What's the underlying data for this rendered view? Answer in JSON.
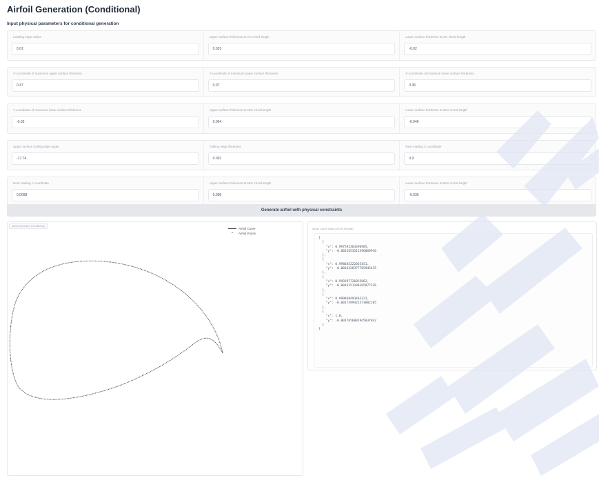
{
  "app": {
    "title": "Airfoil Generation (Conditional)",
    "subtitle": "Input physical parameters for conditional generation"
  },
  "params": [
    [
      {
        "label": "Leading edge radius",
        "value": "0.01"
      },
      {
        "label": "Upper surface thickness at 4% chord length",
        "value": "0.033"
      },
      {
        "label": "Lower surface thickness at 4% chord length",
        "value": "-0.02"
      }
    ],
    [
      {
        "label": "X-coordinate of maximum upper surface thickness",
        "value": "0.47"
      },
      {
        "label": "Y-coordinate of maximum upper surface thickness",
        "value": "0.07"
      },
      {
        "label": "X-coordinate of maximum lower surface thickness",
        "value": "0.36"
      }
    ],
    [
      {
        "label": "Y-coordinate of maximum lower surface thickness",
        "value": "-0.05"
      },
      {
        "label": "Upper surface thickness at 25% chord length",
        "value": "0.064"
      },
      {
        "label": "Lower surface thickness at 25% chord length",
        "value": "-0.046"
      }
    ],
    [
      {
        "label": "Upper surface trailing edge angle",
        "value": "-17.74"
      },
      {
        "label": "Trailing edge thickness",
        "value": "0.002"
      },
      {
        "label": "Rear loading X coordinate",
        "value": "0.9"
      }
    ],
    [
      {
        "label": "Rear loading Y coordinate",
        "value": "0.0098"
      },
      {
        "label": "Upper surface thickness at 60% chord length",
        "value": "0.068"
      },
      {
        "label": "Lower surface thickness at 60% chord length",
        "value": "-0.036"
      }
    ]
  ],
  "generate_button": "Generate airfoil with physical constraints",
  "plot": {
    "tag": "Airfoil Generation (Conditional)",
    "legend": {
      "curve": "Airfoil Curve",
      "points": "Airfoil Points"
    }
  },
  "json_output": {
    "label": "Airfoil Curve Data (JSON Format)",
    "text": "[\n  {\n    \"x\": 0.997592363396985,\n    \"y\": -0.0012653515396869936\n  },\n  {\n    \"x\": 0.998645222035451,\n    \"y\": -0.0014228377765945435\n  },\n  {\n    \"x\": 0.999397726025862,\n    \"y\": -0.0016151188165877236\n  },\n  {\n    \"x\": 0.999848493463321,\n    \"y\": -0.0017399421373802185\n  },\n  {\n    \"x\": 1.0,\n    \"y\": -0.0017656081945037842\n  }\n]"
  },
  "colors": {
    "curve": "#444444",
    "button_bg": "#e5e7eb",
    "watermark": "#dfe6f3"
  }
}
